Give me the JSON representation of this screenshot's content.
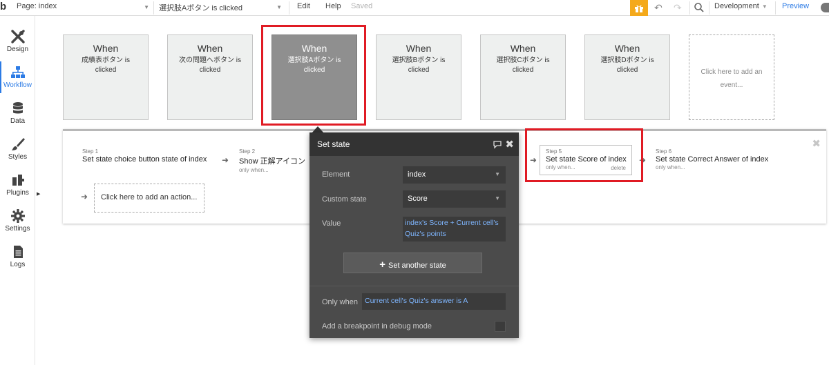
{
  "topbar": {
    "logo": "b",
    "page_label": "Page: index",
    "workflow_label": "選択肢Aボタン is clicked",
    "edit": "Edit",
    "help": "Help",
    "saved": "Saved",
    "environment": "Development",
    "preview": "Preview"
  },
  "sidebar": {
    "items": [
      {
        "label": "Design",
        "icon": "design-icon"
      },
      {
        "label": "Workflow",
        "icon": "workflow-icon"
      },
      {
        "label": "Data",
        "icon": "data-icon"
      },
      {
        "label": "Styles",
        "icon": "styles-icon"
      },
      {
        "label": "Plugins",
        "icon": "plugins-icon"
      },
      {
        "label": "Settings",
        "icon": "settings-icon"
      },
      {
        "label": "Logs",
        "icon": "logs-icon"
      }
    ]
  },
  "events": [
    {
      "when": "When",
      "desc": "成績表ボタン is clicked"
    },
    {
      "when": "When",
      "desc": "次の問題へボタン is clicked"
    },
    {
      "when": "When",
      "desc": "選択肢Aボタン is clicked"
    },
    {
      "when": "When",
      "desc": "選択肢Bボタン is clicked"
    },
    {
      "when": "When",
      "desc": "選択肢Cボタン is clicked"
    },
    {
      "when": "When",
      "desc": "選択肢Dボタン is clicked"
    },
    {
      "when": "",
      "desc": "Click here to add an event..."
    }
  ],
  "steps": [
    {
      "num": "Step 1",
      "title": "Set state choice button state of index",
      "only": ""
    },
    {
      "num": "Step 2",
      "title": "Show 正解アイコン",
      "only": "only when..."
    },
    {
      "num": "Step 5",
      "title": "Set state Score of index",
      "only": "only when...",
      "delete": "delete"
    },
    {
      "num": "Step 6",
      "title": "Set state Correct Answer of index",
      "only": "only when..."
    }
  ],
  "add_action": "Click here to add an action...",
  "popup": {
    "title": "Set state",
    "element_label": "Element",
    "element_value": "index",
    "custom_state_label": "Custom state",
    "custom_state_value": "Score",
    "value_label": "Value",
    "value_expr": "index's Score + Current cell's Quiz's points",
    "set_another": "Set another state",
    "only_when_label": "Only when",
    "only_when_value": "Current cell's Quiz's answer is A",
    "breakpoint_label": "Add a breakpoint in debug mode"
  },
  "colors": {
    "accent": "#2c7be5",
    "highlight_red": "#e01b24",
    "popup_bg": "#4b4b4b",
    "upgrade": "#f4a91b"
  }
}
